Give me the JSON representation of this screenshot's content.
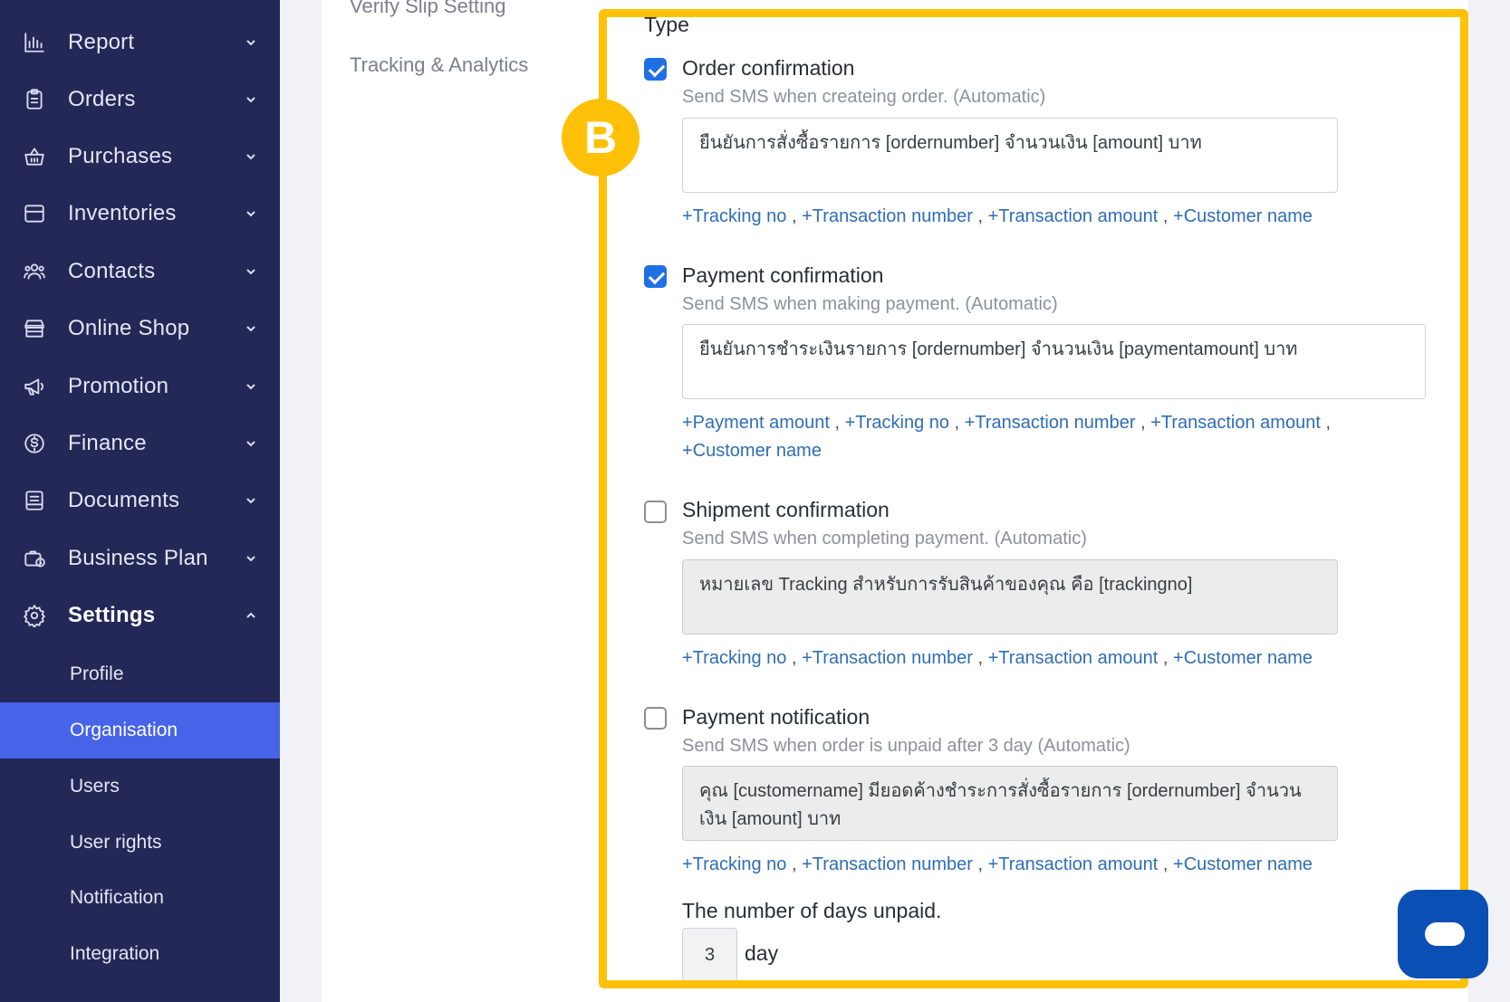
{
  "sidebar": {
    "items": [
      {
        "label": "Report",
        "icon": "bar-chart-icon"
      },
      {
        "label": "Orders",
        "icon": "clipboard-icon"
      },
      {
        "label": "Purchases",
        "icon": "basket-icon"
      },
      {
        "label": "Inventories",
        "icon": "box-icon"
      },
      {
        "label": "Contacts",
        "icon": "people-icon"
      },
      {
        "label": "Online Shop",
        "icon": "store-icon"
      },
      {
        "label": "Promotion",
        "icon": "megaphone-icon"
      },
      {
        "label": "Finance",
        "icon": "dollar-circle-icon"
      },
      {
        "label": "Documents",
        "icon": "document-icon"
      },
      {
        "label": "Business Plan",
        "icon": "briefcase-icon"
      },
      {
        "label": "Settings",
        "icon": "gear-icon"
      }
    ],
    "settings_children": [
      {
        "label": "Profile"
      },
      {
        "label": "Organisation"
      },
      {
        "label": "Users"
      },
      {
        "label": "User rights"
      },
      {
        "label": "Notification"
      },
      {
        "label": "Integration"
      }
    ]
  },
  "settings_menu": {
    "verify_slip": "Verify Slip Setting",
    "tracking": "Tracking & Analytics"
  },
  "main": {
    "type_heading": "Type",
    "badge": "B",
    "blocks": [
      {
        "title": "Order confirmation",
        "checked": true,
        "description": "Send SMS when createing order. (Automatic)",
        "message": "ยืนยันการสั่งซื้อรายการ [ordernumber] จำนวนเงิน [amount] บาท",
        "tags": [
          "+Tracking no",
          "+Transaction number",
          "+Transaction amount",
          "+Customer name"
        ]
      },
      {
        "title": "Payment confirmation",
        "checked": true,
        "description": "Send SMS when making payment. (Automatic)",
        "message": "ยืนยันการชำระเงินรายการ [ordernumber] จำนวนเงิน [paymentamount] บาท",
        "tags": [
          "+Payment amount",
          "+Tracking no",
          "+Transaction number",
          "+Transaction amount",
          "+Customer name"
        ]
      },
      {
        "title": "Shipment confirmation",
        "checked": false,
        "description": "Send SMS when completing payment. (Automatic)",
        "message": "หมายเลข Tracking สำหรับการรับสินค้าของคุณ คือ [trackingno]",
        "tags": [
          "+Tracking no",
          "+Transaction number",
          "+Transaction amount",
          "+Customer name"
        ]
      },
      {
        "title": "Payment notification",
        "checked": false,
        "description": "Send SMS when order is unpaid after 3 day (Automatic)",
        "message": "คุณ [customername] มียอดค้างชำระการสั่งซื้อรายการ [ordernumber] จำนวนเงิน [amount] บาท",
        "tags": [
          "+Tracking no",
          "+Transaction number",
          "+Transaction amount",
          "+Customer name"
        ]
      }
    ],
    "days_label": "The number of days unpaid.",
    "days_value": "3",
    "days_unit": "day",
    "separator": ","
  },
  "colors": {
    "sidebar_bg": "#232857",
    "active_item": "#4764e8",
    "highlight": "#ffc107",
    "link": "#2f6db5",
    "checkbox": "#1f6fe5",
    "chat": "#0a4fb4"
  }
}
